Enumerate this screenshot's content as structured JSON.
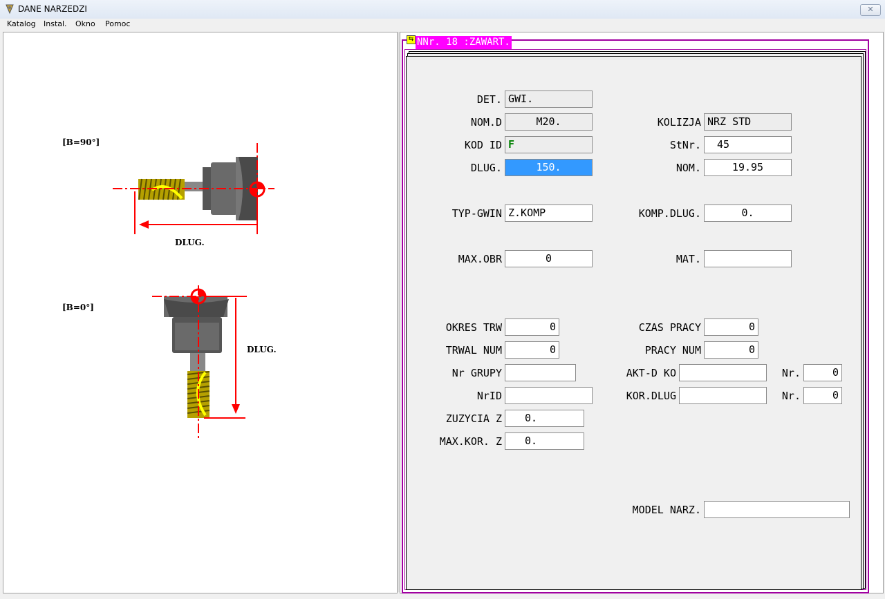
{
  "window": {
    "title": "DANE NARZEDZI"
  },
  "menu": [
    "Katalog",
    "Instal.",
    "Okno",
    "Pomoc"
  ],
  "drawing": {
    "top_view_label": "[B=90°]",
    "side_view_label": "[B=0°]",
    "dlug_label_1": "DLUG.",
    "dlug_label_2": "DLUG."
  },
  "panel": {
    "tab_title": "NNr. 18 :ZAWART.",
    "fields": {
      "det": {
        "label": "DET.",
        "value": "GWI."
      },
      "nom_d": {
        "label": "NOM.D",
        "value": "M20."
      },
      "kod_id": {
        "label": "KOD ID",
        "value": "F"
      },
      "dlug": {
        "label": "DLUG.",
        "value": "150."
      },
      "kolizja": {
        "label": "KOLIZJA",
        "value": "NRZ STD"
      },
      "stnr": {
        "label": "StNr.",
        "value": "45"
      },
      "nom": {
        "label": "NOM.",
        "value": "19.95"
      },
      "typ_gwin": {
        "label": "TYP-GWIN",
        "value": "Z.KOMP"
      },
      "komp_dlug": {
        "label": "KOMP.DLUG.",
        "value": "0."
      },
      "max_obr": {
        "label": "MAX.OBR",
        "value": "0"
      },
      "mat": {
        "label": "MAT.",
        "value": ""
      },
      "okres_trw": {
        "label": "OKRES TRW",
        "value": "0"
      },
      "trwal_num": {
        "label": "TRWAL NUM",
        "value": "0"
      },
      "nr_grupy": {
        "label": "Nr GRUPY",
        "value": ""
      },
      "nrid": {
        "label": "NrID",
        "value": ""
      },
      "zuzycia_z": {
        "label": "ZUZYCIA Z",
        "value": "0."
      },
      "max_kor_z": {
        "label": "MAX.KOR. Z",
        "value": "0."
      },
      "czas_pracy": {
        "label": "CZAS PRACY",
        "value": "0"
      },
      "pracy_num": {
        "label": "PRACY NUM",
        "value": "0"
      },
      "akt_d_ko": {
        "label": "AKT-D KO",
        "value": ""
      },
      "akt_nr": {
        "label": "Nr.",
        "value": "0"
      },
      "kor_dlug": {
        "label": "KOR.DLUG",
        "value": ""
      },
      "kor_nr": {
        "label": "Nr.",
        "value": "0"
      },
      "model_narz": {
        "label": "MODEL NARZ.",
        "value": ""
      }
    }
  }
}
